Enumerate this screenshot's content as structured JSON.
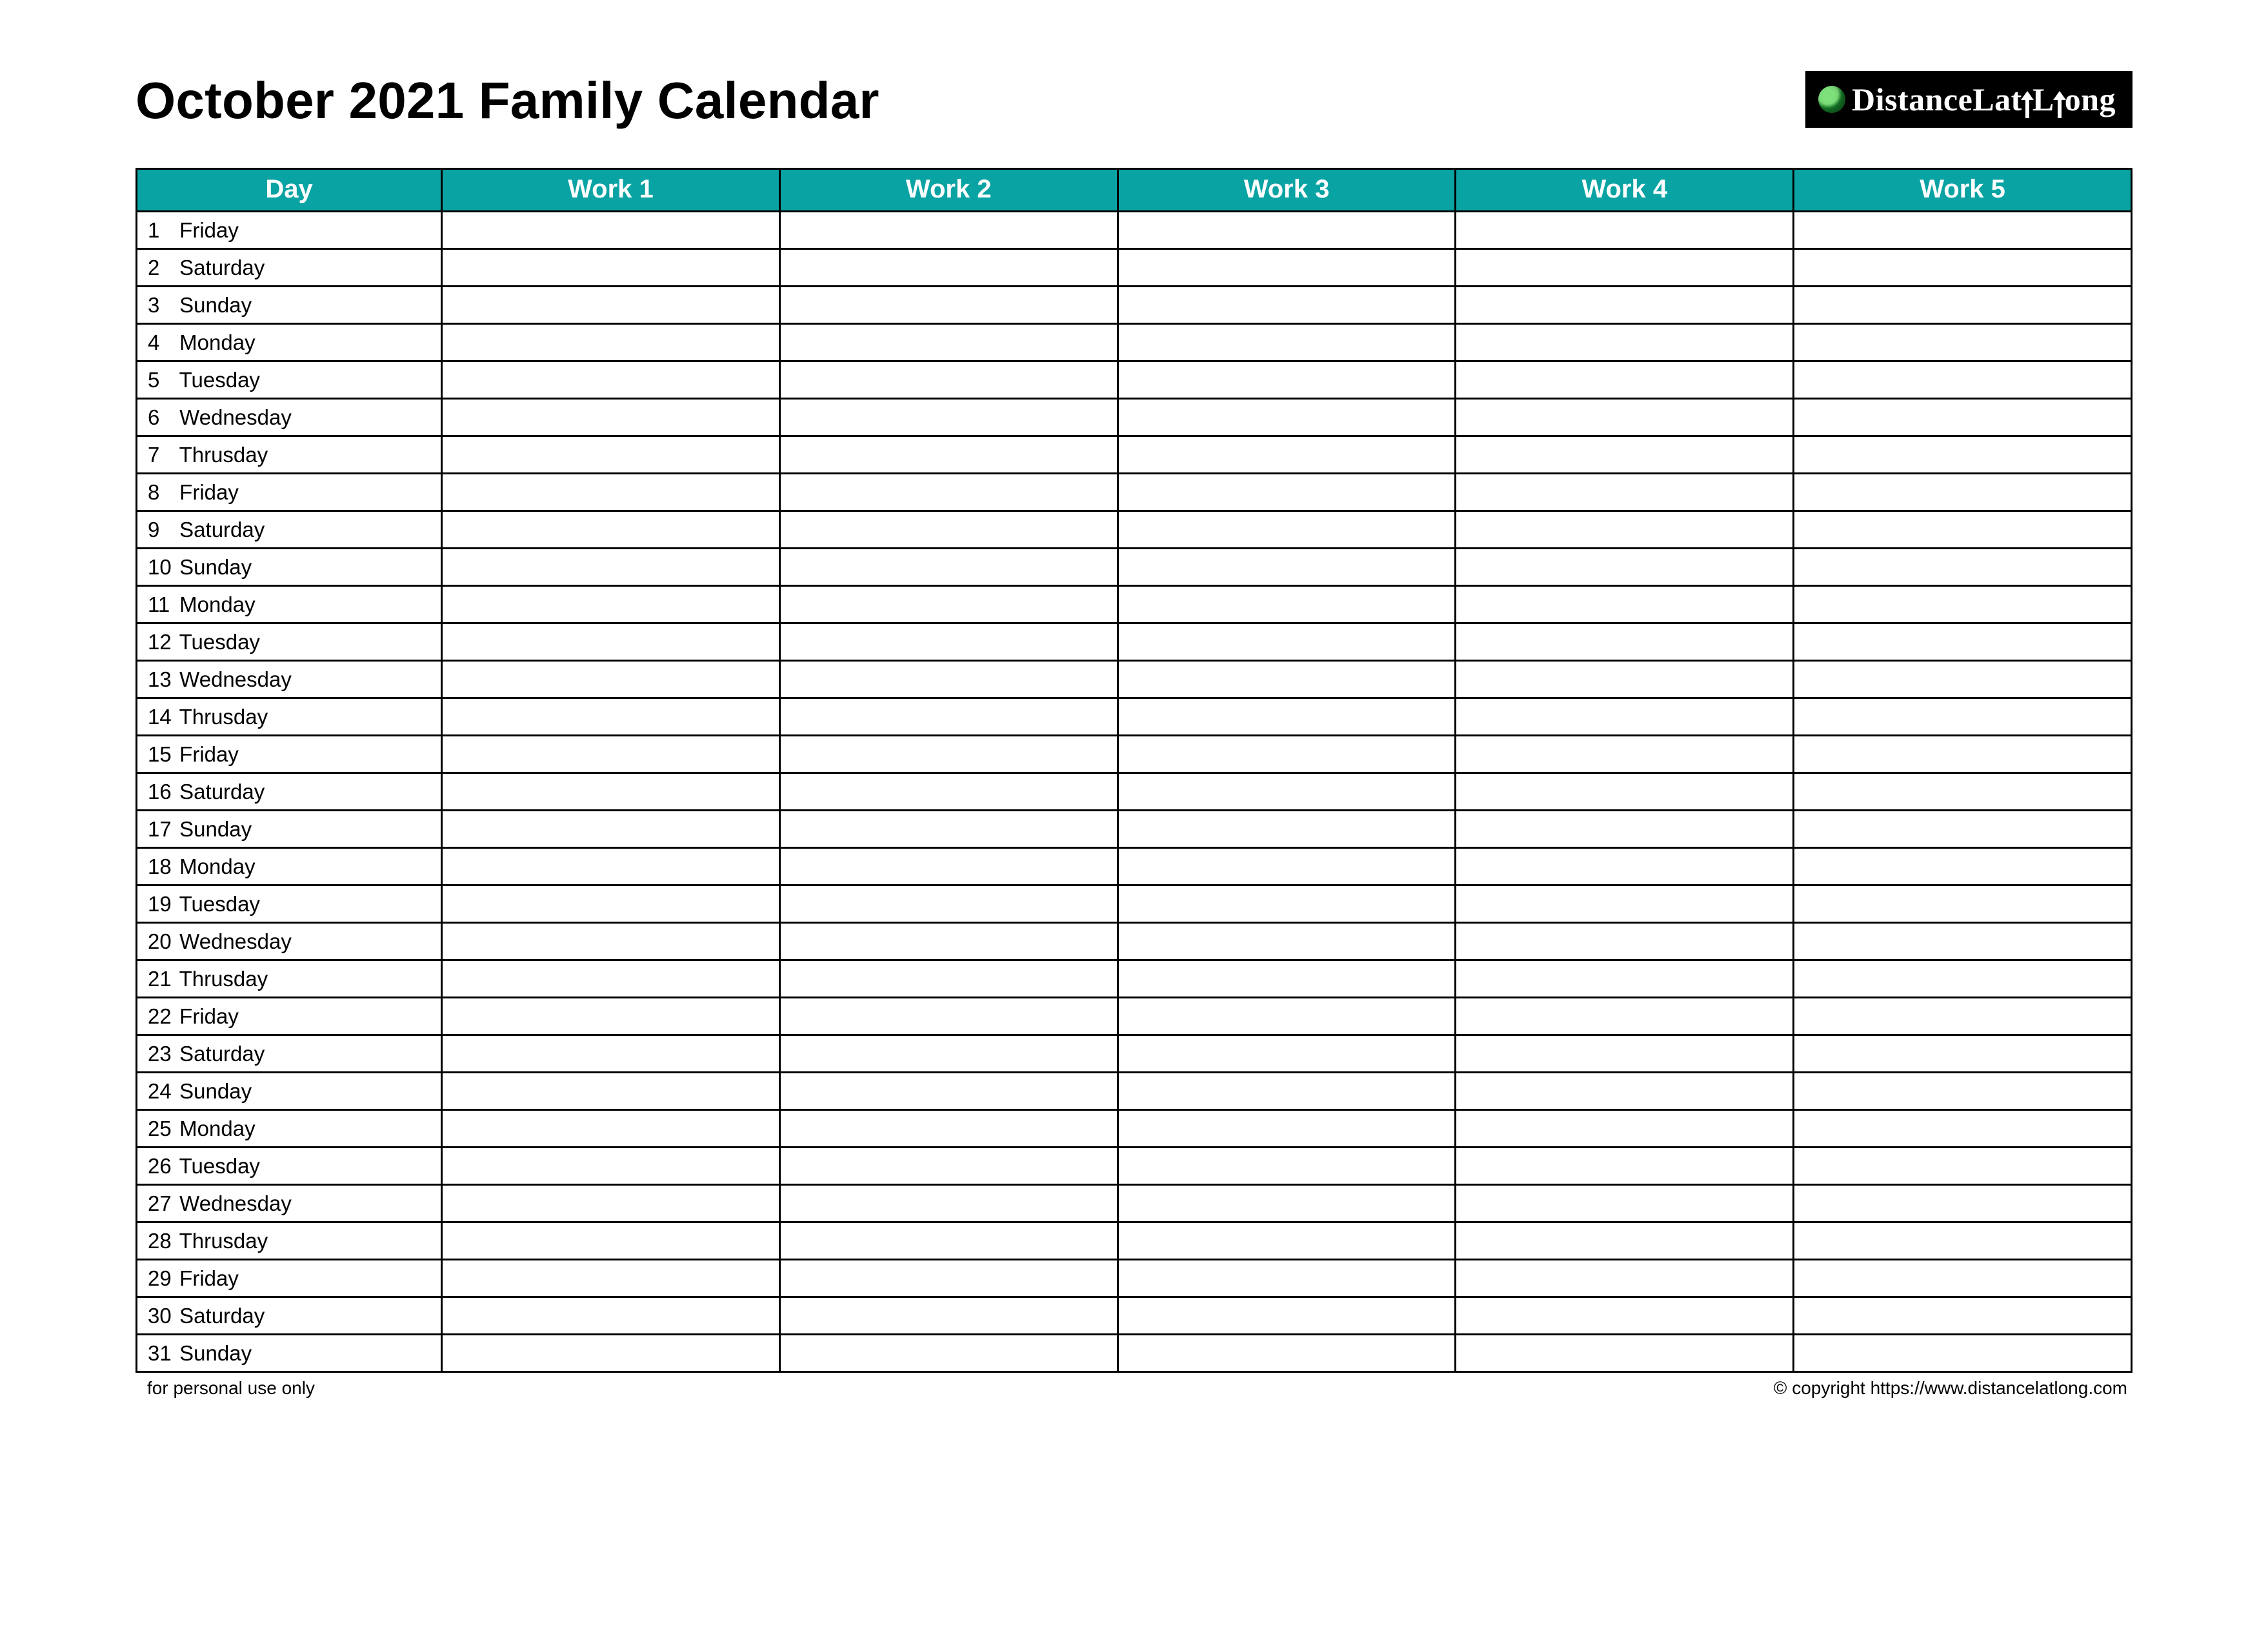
{
  "header": {
    "title": "October 2021 Family Calendar",
    "logo": {
      "pre": "istance",
      "mid1": "at",
      "mid2": "ong",
      "letter_d": "D",
      "letter_l1": "L",
      "letter_l2": "L"
    }
  },
  "columns": [
    "Day",
    "Work 1",
    "Work 2",
    "Work 3",
    "Work 4",
    "Work 5"
  ],
  "days": [
    {
      "n": "1",
      "name": "Friday"
    },
    {
      "n": "2",
      "name": "Saturday"
    },
    {
      "n": "3",
      "name": "Sunday"
    },
    {
      "n": "4",
      "name": "Monday"
    },
    {
      "n": "5",
      "name": "Tuesday"
    },
    {
      "n": "6",
      "name": "Wednesday"
    },
    {
      "n": "7",
      "name": "Thrusday"
    },
    {
      "n": "8",
      "name": "Friday"
    },
    {
      "n": "9",
      "name": "Saturday"
    },
    {
      "n": "10",
      "name": "Sunday"
    },
    {
      "n": "11",
      "name": "Monday"
    },
    {
      "n": "12",
      "name": "Tuesday"
    },
    {
      "n": "13",
      "name": "Wednesday"
    },
    {
      "n": "14",
      "name": "Thrusday"
    },
    {
      "n": "15",
      "name": "Friday"
    },
    {
      "n": "16",
      "name": "Saturday"
    },
    {
      "n": "17",
      "name": "Sunday"
    },
    {
      "n": "18",
      "name": "Monday"
    },
    {
      "n": "19",
      "name": "Tuesday"
    },
    {
      "n": "20",
      "name": "Wednesday"
    },
    {
      "n": "21",
      "name": "Thrusday"
    },
    {
      "n": "22",
      "name": "Friday"
    },
    {
      "n": "23",
      "name": "Saturday"
    },
    {
      "n": "24",
      "name": "Sunday"
    },
    {
      "n": "25",
      "name": "Monday"
    },
    {
      "n": "26",
      "name": "Tuesday"
    },
    {
      "n": "27",
      "name": "Wednesday"
    },
    {
      "n": "28",
      "name": "Thrusday"
    },
    {
      "n": "29",
      "name": "Friday"
    },
    {
      "n": "30",
      "name": "Saturday"
    },
    {
      "n": "31",
      "name": "Sunday"
    }
  ],
  "footer": {
    "left": "for personal use only",
    "right": "© copyright https://www.distancelatlong.com"
  }
}
